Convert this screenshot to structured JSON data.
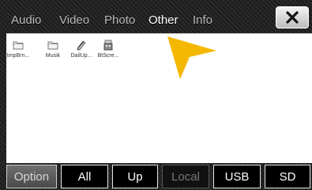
{
  "tabs": [
    {
      "label": "Audio",
      "active": false
    },
    {
      "label": "Video",
      "active": false
    },
    {
      "label": "Photo",
      "active": false
    },
    {
      "label": "Other",
      "active": true
    },
    {
      "label": "Info",
      "active": false
    }
  ],
  "close_icon": "close-icon",
  "files": [
    {
      "label": "tmpBrn...",
      "icon": "folder-icon"
    },
    {
      "label": "Musik",
      "icon": "folder-icon"
    },
    {
      "label": "DailUp...",
      "icon": "application-icon"
    },
    {
      "label": "BtScre...",
      "icon": "application-icon"
    }
  ],
  "buttons": [
    {
      "label": "Option",
      "enabled": true
    },
    {
      "label": "All",
      "enabled": true
    },
    {
      "label": "Up",
      "enabled": true
    },
    {
      "label": "Local",
      "enabled": false
    },
    {
      "label": "USB",
      "enabled": true
    },
    {
      "label": "SD",
      "enabled": true
    }
  ],
  "colors": {
    "accent": "#F5B800",
    "panel": "#FFFFFF"
  }
}
